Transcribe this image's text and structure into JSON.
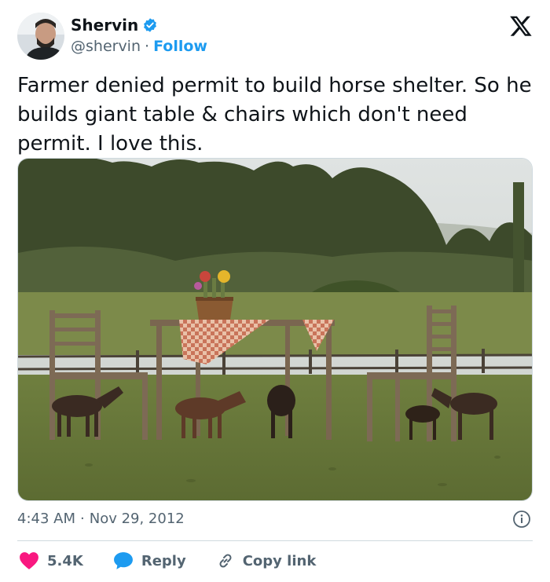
{
  "author": {
    "name": "Shervin",
    "handle": "@shervin",
    "separator": "·",
    "follow_label": "Follow"
  },
  "tweet": {
    "text": "Farmer denied permit to build horse shelter. So he builds giant table & chairs which don't need permit. I love this."
  },
  "meta": {
    "time": "4:43 AM",
    "separator": "·",
    "date": "Nov 29, 2012"
  },
  "actions": {
    "likes": "5.4K",
    "reply_label": "Reply",
    "copy_link_label": "Copy link"
  },
  "colors": {
    "accent": "#1d9bf0",
    "like": "#f91880",
    "muted": "#536471"
  },
  "icons": [
    "verified-badge-icon",
    "x-logo-icon",
    "info-icon",
    "heart-icon",
    "reply-bubble-icon",
    "link-icon"
  ]
}
